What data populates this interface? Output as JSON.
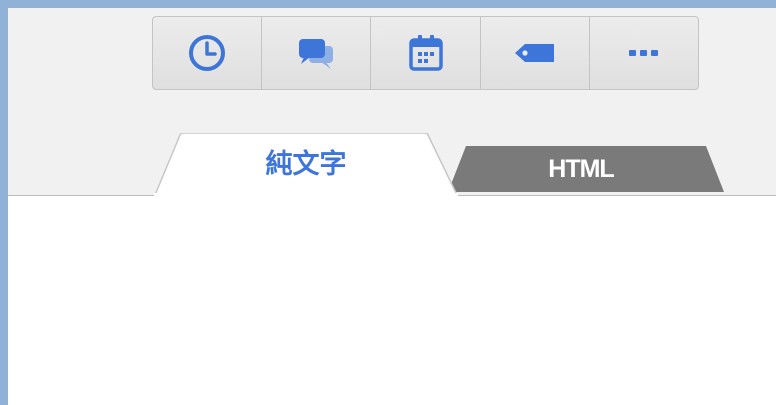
{
  "toolbar": {
    "buttons": [
      {
        "icon": "clock-icon",
        "color": "#3d76d8"
      },
      {
        "icon": "chat-icon",
        "color": "#3d76d8"
      },
      {
        "icon": "calendar-icon",
        "color": "#3d76d8"
      },
      {
        "icon": "tag-icon",
        "color": "#3d76d8"
      },
      {
        "icon": "more-icon",
        "color": "#3d76d8"
      }
    ]
  },
  "tabs": {
    "plain_label": "純文字",
    "html_label": "HTML",
    "active": "plain"
  },
  "colors": {
    "accent": "#3d76d8",
    "inactive_tab": "#7a7a7a",
    "background": "#f1f1f1",
    "frame": "#8fb2d6"
  }
}
